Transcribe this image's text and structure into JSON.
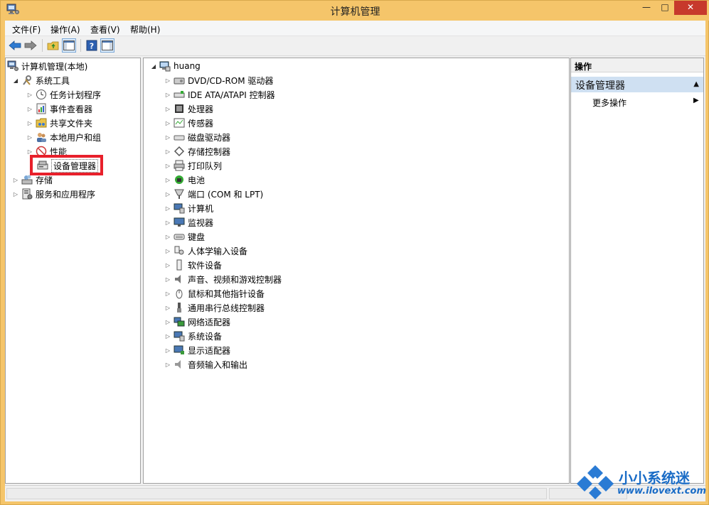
{
  "window": {
    "title": "计算机管理",
    "min_label": "—",
    "max_label": "□",
    "close_label": "✕"
  },
  "menu": {
    "items": [
      "文件(F)",
      "操作(A)",
      "查看(V)",
      "帮助(H)"
    ]
  },
  "toolbar": {
    "buttons": [
      "back-icon",
      "forward-icon",
      "up-folder-icon",
      "show-hide-tree-icon",
      "help-icon",
      "show-hide-action-pane-icon"
    ]
  },
  "left_tree": {
    "root": "计算机管理(本地)",
    "system_tools": "系统工具",
    "items": [
      "任务计划程序",
      "事件查看器",
      "共享文件夹",
      "本地用户和组",
      "性能",
      "设备管理器"
    ],
    "storage": "存储",
    "services": "服务和应用程序"
  },
  "device_tree": {
    "root": "huang",
    "items": [
      "DVD/CD-ROM 驱动器",
      "IDE ATA/ATAPI 控制器",
      "处理器",
      "传感器",
      "磁盘驱动器",
      "存储控制器",
      "打印队列",
      "电池",
      "端口 (COM 和 LPT)",
      "计算机",
      "监视器",
      "键盘",
      "人体学输入设备",
      "软件设备",
      "声音、视频和游戏控制器",
      "鼠标和其他指针设备",
      "通用串行总线控制器",
      "网络适配器",
      "系统设备",
      "显示适配器",
      "音频输入和输出"
    ]
  },
  "actions": {
    "header": "操作",
    "group": "设备管理器",
    "more": "更多操作"
  },
  "watermark": {
    "title": "小小系统迷",
    "url": "www.ilovext.com"
  },
  "colors": {
    "title_bar": "#f5c56a",
    "selection_highlight": "#e8202b",
    "action_group_bg": "#cfe0f2",
    "watermark_blue": "#1a6cc6"
  }
}
